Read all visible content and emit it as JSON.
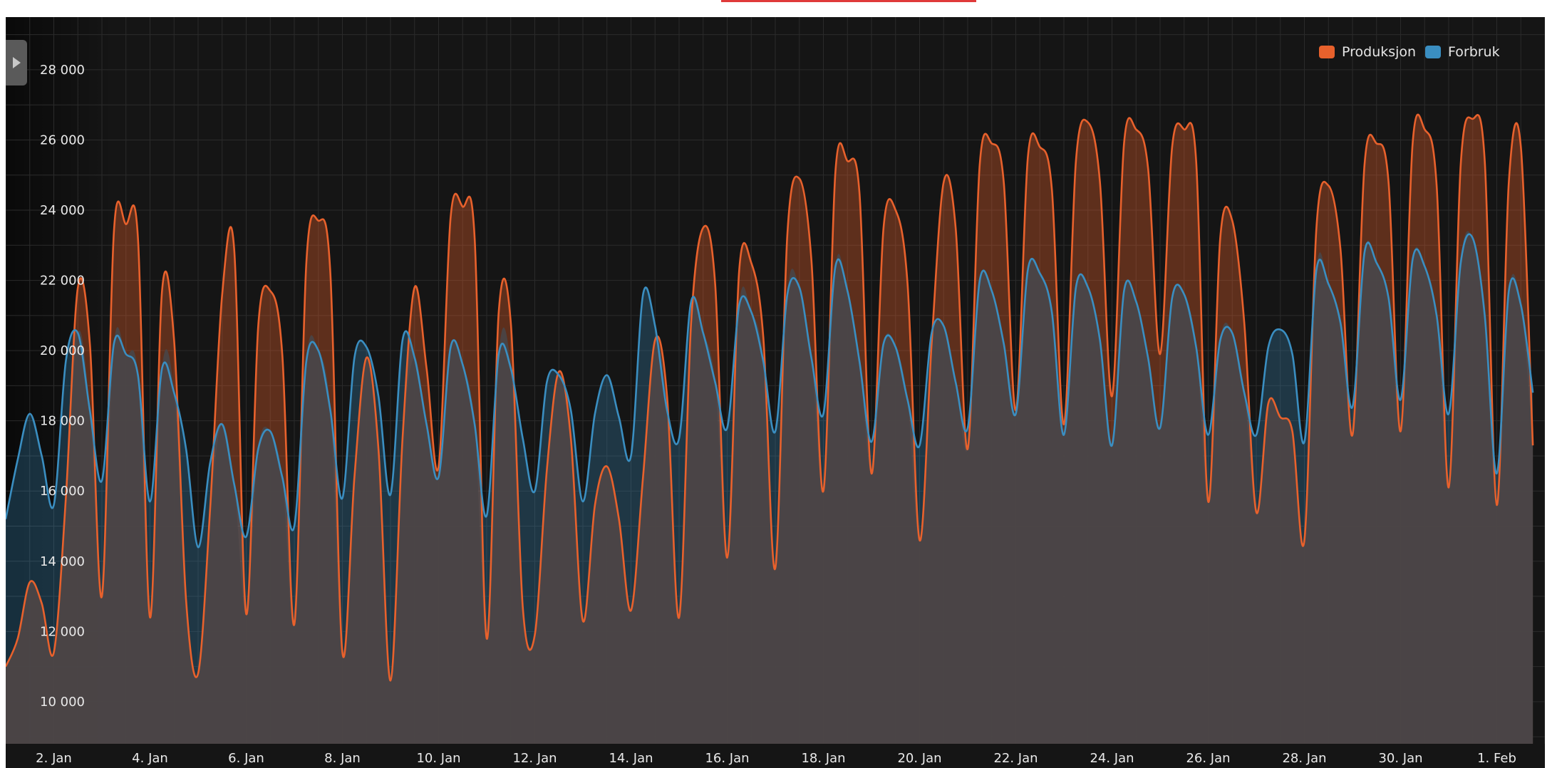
{
  "colors": {
    "produksjon": "#e8612c",
    "forbruk": "#3a8ec1",
    "background": "#151515",
    "lower_area": "#4a4546"
  },
  "chart_data": {
    "type": "area",
    "title": "",
    "xlabel": "",
    "ylabel": "",
    "ylim": [
      8800,
      29500
    ],
    "x_range": [
      "1. Jan",
      "2. Feb"
    ],
    "y_ticks": [
      10000,
      12000,
      14000,
      16000,
      18000,
      20000,
      22000,
      24000,
      26000,
      28000
    ],
    "y_tick_labels": [
      "10 000",
      "12 000",
      "14 000",
      "16 000",
      "18 000",
      "20 000",
      "22 000",
      "24 000",
      "26 000",
      "28 000"
    ],
    "x_tick_labels": [
      "2. Jan",
      "4. Jan",
      "6. Jan",
      "8. Jan",
      "10. Jan",
      "12. Jan",
      "14. Jan",
      "16. Jan",
      "18. Jan",
      "20. Jan",
      "22. Jan",
      "24. Jan",
      "26. Jan",
      "28. Jan",
      "30. Jan",
      "1. Feb"
    ],
    "x_tick_days": [
      2,
      4,
      6,
      8,
      10,
      12,
      14,
      16,
      18,
      20,
      22,
      24,
      26,
      28,
      30,
      32
    ],
    "grid": true,
    "legend_position": "top-right",
    "series": [
      {
        "name": "Produksjon",
        "x_day": [
          1.0,
          1.25,
          1.5,
          1.75,
          2.0,
          2.25,
          2.5,
          2.75,
          3.0,
          3.25,
          3.5,
          3.75,
          4.0,
          4.25,
          4.5,
          4.75,
          5.0,
          5.25,
          5.5,
          5.75,
          6.0,
          6.25,
          6.5,
          6.75,
          7.0,
          7.25,
          7.5,
          7.75,
          8.0,
          8.25,
          8.5,
          8.75,
          9.0,
          9.25,
          9.5,
          9.75,
          10.0,
          10.25,
          10.5,
          10.75,
          11.0,
          11.25,
          11.5,
          11.75,
          12.0,
          12.25,
          12.5,
          12.75,
          13.0,
          13.25,
          13.5,
          13.75,
          14.0,
          14.25,
          14.5,
          14.75,
          15.0,
          15.25,
          15.5,
          15.75,
          16.0,
          16.25,
          16.5,
          16.75,
          17.0,
          17.25,
          17.5,
          17.75,
          18.0,
          18.25,
          18.5,
          18.75,
          19.0,
          19.25,
          19.5,
          19.75,
          20.0,
          20.25,
          20.5,
          20.75,
          21.0,
          21.25,
          21.5,
          21.75,
          22.0,
          22.25,
          22.5,
          22.75,
          23.0,
          23.25,
          23.5,
          23.75,
          24.0,
          24.25,
          24.5,
          24.75,
          25.0,
          25.25,
          25.5,
          25.75,
          26.0,
          26.25,
          26.5,
          26.75,
          27.0,
          27.25,
          27.5,
          27.75,
          28.0,
          28.25,
          28.5,
          28.75,
          29.0,
          29.25,
          29.5,
          29.75,
          30.0,
          30.25,
          30.5,
          30.75,
          31.0,
          31.25,
          31.5,
          31.75,
          32.0,
          32.25,
          32.5,
          32.75
        ],
        "values": [
          11000,
          11800,
          13400,
          12800,
          11400,
          15800,
          21800,
          20200,
          13000,
          23400,
          23600,
          23200,
          12400,
          21700,
          20300,
          12900,
          10800,
          15500,
          21600,
          22900,
          12500,
          20700,
          21700,
          19900,
          12200,
          22500,
          23700,
          22200,
          11400,
          16400,
          19800,
          17200,
          10600,
          17500,
          21800,
          19500,
          16700,
          23800,
          24100,
          23200,
          11800,
          21100,
          20800,
          12700,
          11900,
          16600,
          19400,
          17500,
          12300,
          15600,
          16700,
          15200,
          12600,
          16400,
          20300,
          18700,
          12400,
          20800,
          23500,
          21900,
          14100,
          22300,
          22500,
          20400,
          13800,
          23300,
          24900,
          22600,
          16000,
          25100,
          25400,
          24500,
          16500,
          23500,
          24000,
          21900,
          14600,
          20200,
          24800,
          23500,
          17200,
          25300,
          25900,
          24800,
          18300,
          25500,
          25800,
          24600,
          17900,
          25400,
          26500,
          24800,
          18700,
          25900,
          26300,
          25200,
          19900,
          25800,
          26300,
          25400,
          15700,
          23200,
          23700,
          20800,
          15400,
          18500,
          18100,
          17700,
          14600,
          23500,
          24700,
          22900,
          17600,
          25300,
          25900,
          24800,
          17700,
          25900,
          26300,
          24700,
          16100,
          25300,
          26600,
          25400,
          15600,
          24800,
          25800,
          17300
        ]
      },
      {
        "name": "Forbruk",
        "x_day": [
          1.0,
          1.25,
          1.5,
          1.75,
          2.0,
          2.25,
          2.5,
          2.75,
          3.0,
          3.25,
          3.5,
          3.75,
          4.0,
          4.25,
          4.5,
          4.75,
          5.0,
          5.25,
          5.5,
          5.75,
          6.0,
          6.25,
          6.5,
          6.75,
          7.0,
          7.25,
          7.5,
          7.75,
          8.0,
          8.25,
          8.5,
          8.75,
          9.0,
          9.25,
          9.5,
          9.75,
          10.0,
          10.25,
          10.5,
          10.75,
          11.0,
          11.25,
          11.5,
          11.75,
          12.0,
          12.25,
          12.5,
          12.75,
          13.0,
          13.25,
          13.5,
          13.75,
          14.0,
          14.25,
          14.5,
          14.75,
          15.0,
          15.25,
          15.5,
          15.75,
          16.0,
          16.25,
          16.5,
          16.75,
          17.0,
          17.25,
          17.5,
          17.75,
          18.0,
          18.25,
          18.5,
          18.75,
          19.0,
          19.25,
          19.5,
          19.75,
          20.0,
          20.25,
          20.5,
          20.75,
          21.0,
          21.25,
          21.5,
          21.75,
          22.0,
          22.25,
          22.5,
          22.75,
          23.0,
          23.25,
          23.5,
          23.75,
          24.0,
          24.25,
          24.5,
          24.75,
          25.0,
          25.25,
          25.5,
          25.75,
          26.0,
          26.25,
          26.5,
          26.75,
          27.0,
          27.25,
          27.5,
          27.75,
          28.0,
          28.25,
          28.5,
          28.75,
          29.0,
          29.25,
          29.5,
          29.75,
          30.0,
          30.25,
          30.5,
          30.75,
          31.0,
          31.25,
          31.5,
          31.75,
          32.0,
          32.25,
          32.5,
          32.75
        ],
        "values": [
          15200,
          16900,
          18200,
          17000,
          15600,
          19700,
          20500,
          18300,
          16300,
          20200,
          19900,
          19300,
          15700,
          19500,
          18800,
          17200,
          14400,
          16800,
          17900,
          16200,
          14700,
          17200,
          17700,
          16400,
          15000,
          19700,
          20000,
          18300,
          15800,
          19800,
          20100,
          18700,
          15900,
          20300,
          19800,
          17900,
          16400,
          20100,
          19600,
          17900,
          15300,
          19900,
          19500,
          17500,
          16000,
          19100,
          19300,
          18300,
          15700,
          18200,
          19300,
          18100,
          17000,
          21600,
          20700,
          18300,
          17500,
          21400,
          20500,
          19100,
          17800,
          21300,
          21100,
          19700,
          17700,
          21600,
          21800,
          19800,
          18200,
          22400,
          21700,
          19700,
          17400,
          20200,
          20100,
          18600,
          17300,
          20500,
          20700,
          19100,
          17800,
          22000,
          21700,
          20200,
          18200,
          22300,
          22200,
          21100,
          17600,
          21800,
          21800,
          20300,
          17300,
          21700,
          21400,
          19800,
          17800,
          21500,
          21600,
          20100,
          17600,
          20300,
          20500,
          18800,
          17600,
          20100,
          20600,
          19900,
          17400,
          22300,
          21900,
          20800,
          18400,
          22800,
          22500,
          21500,
          18600,
          22600,
          22400,
          21000,
          18200,
          22500,
          23200,
          21000,
          16500,
          21700,
          21300,
          18800
        ]
      }
    ]
  }
}
